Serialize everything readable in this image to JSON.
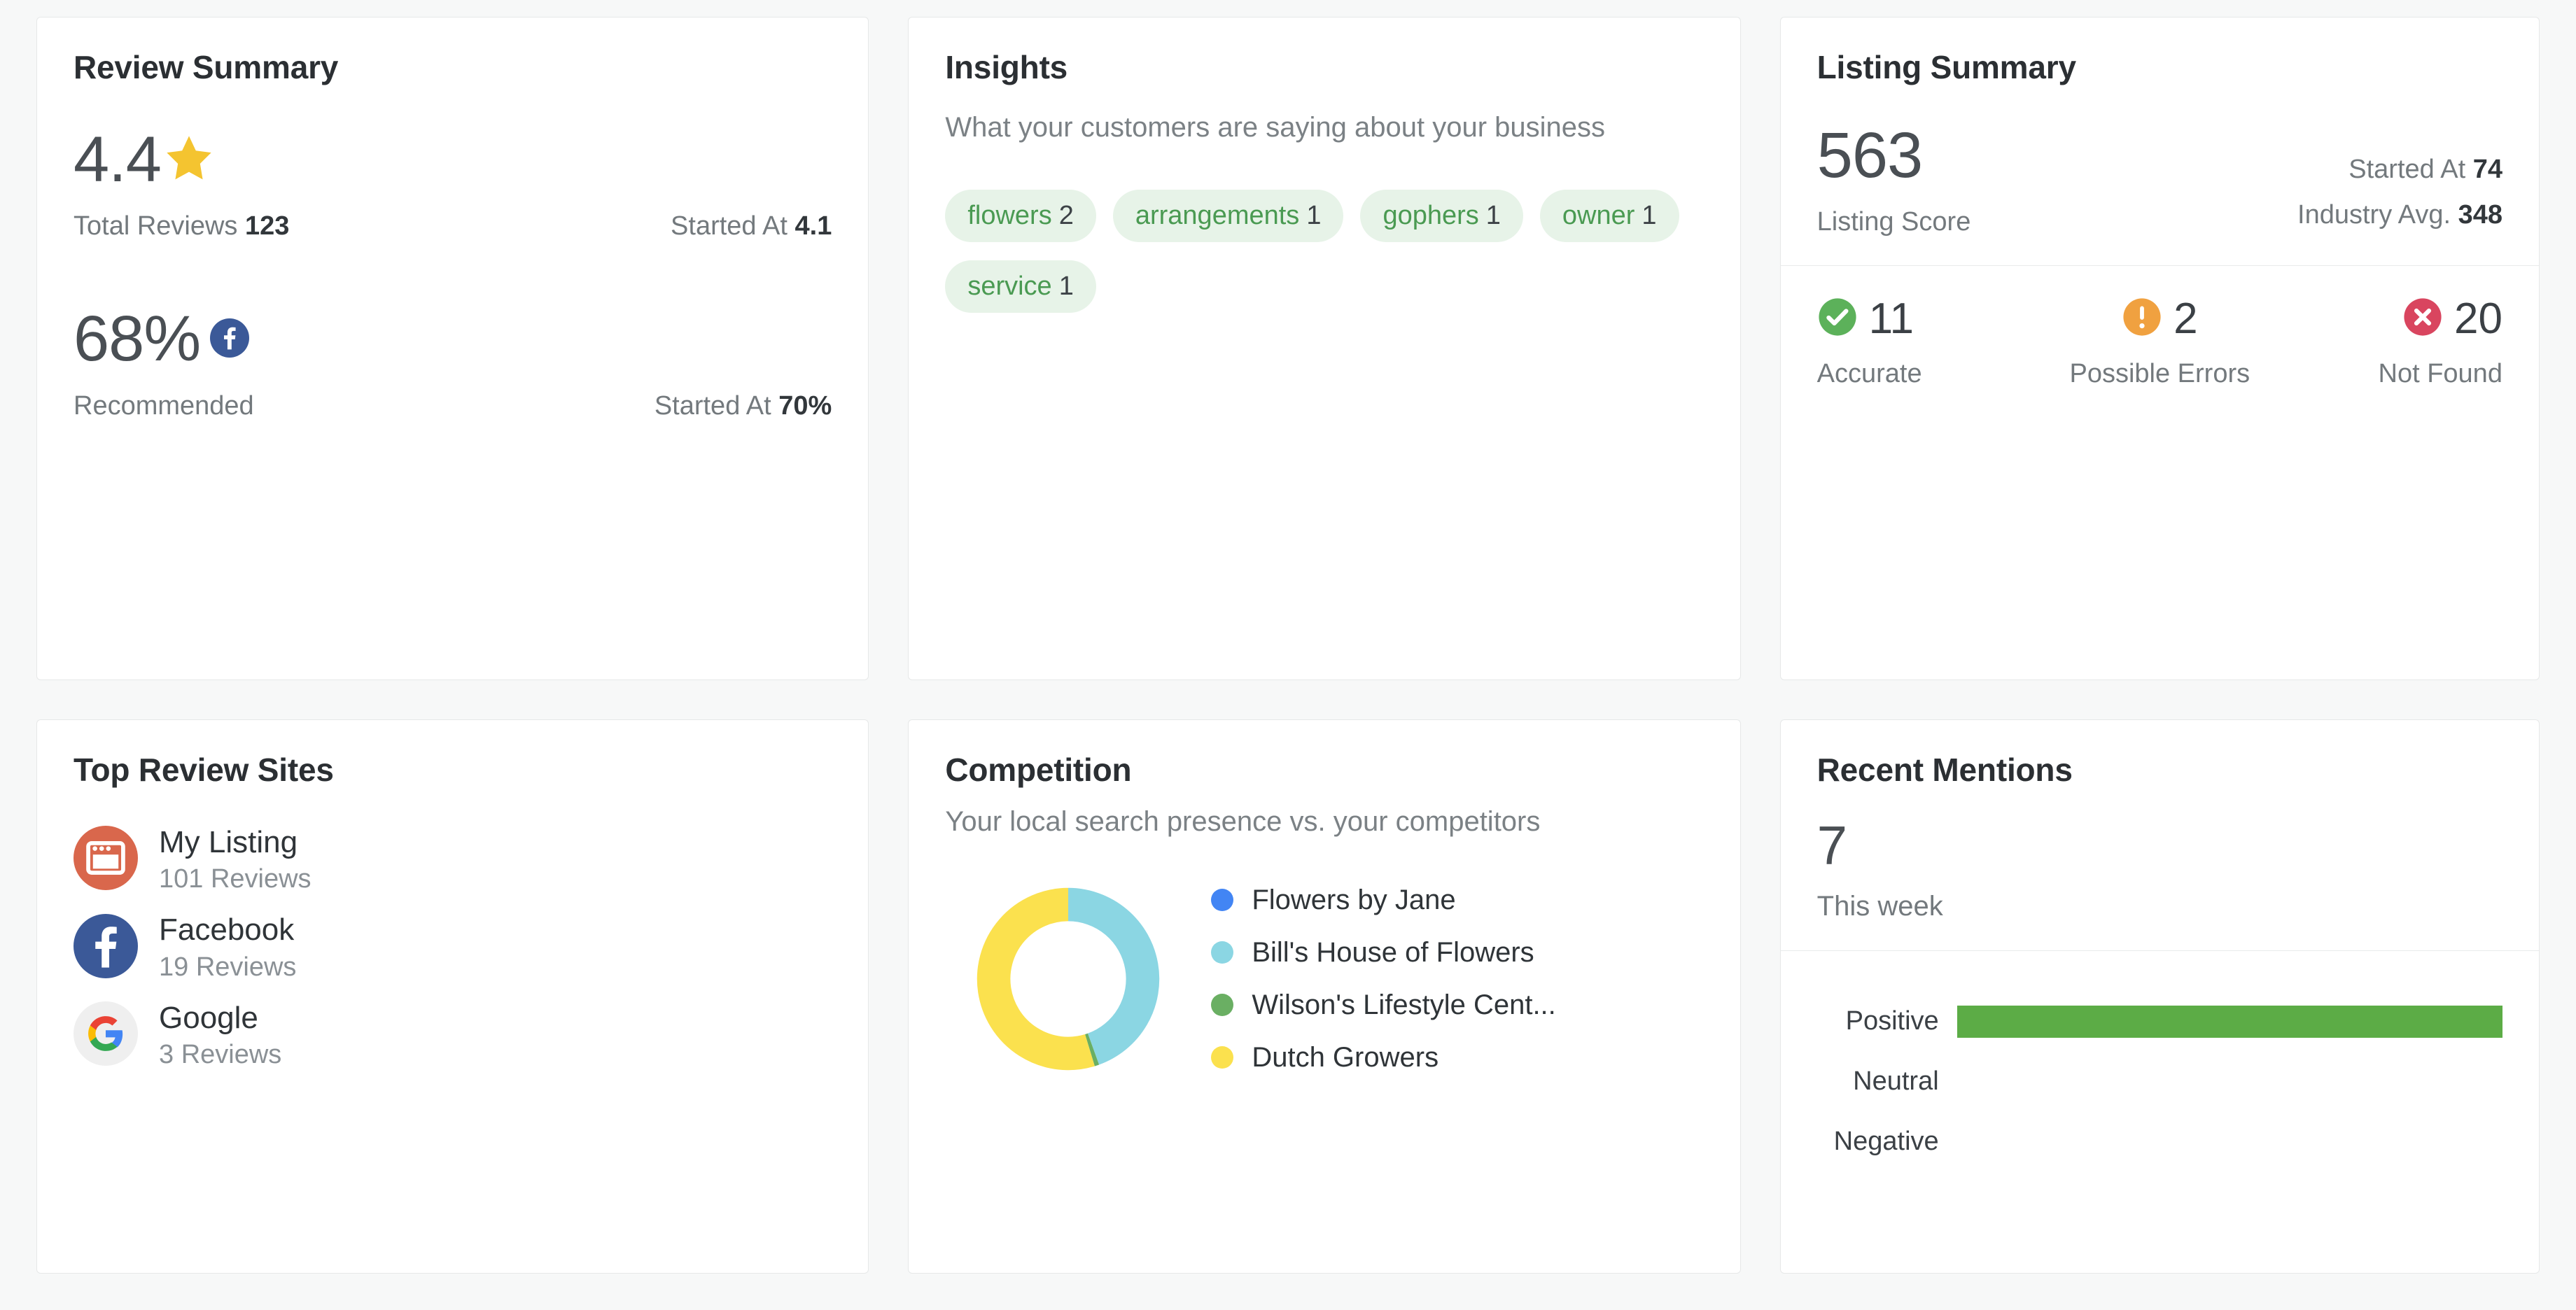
{
  "review_summary": {
    "title": "Review Summary",
    "rating": "4.4",
    "rating_icon": "star-icon",
    "total_reviews_label": "Total Reviews",
    "total_reviews_value": "123",
    "rating_started_label": "Started At",
    "rating_started_value": "4.1",
    "recommend_percent": "68%",
    "recommend_icon": "facebook-icon",
    "recommend_label": "Recommended",
    "recommend_started_label": "Started At",
    "recommend_started_value": "70%"
  },
  "insights": {
    "title": "Insights",
    "subtitle": "What your customers are saying about your business",
    "tags": [
      {
        "label": "flowers",
        "count": "2"
      },
      {
        "label": "arrangements",
        "count": "1"
      },
      {
        "label": "gophers",
        "count": "1"
      },
      {
        "label": "owner",
        "count": "1"
      },
      {
        "label": "service",
        "count": "1"
      }
    ]
  },
  "listing_summary": {
    "title": "Listing Summary",
    "score": "563",
    "score_label": "Listing Score",
    "started_label": "Started At",
    "started_value": "74",
    "industry_label": "Industry Avg.",
    "industry_value": "348",
    "statuses": [
      {
        "icon": "check-circle-icon",
        "value": "11",
        "label": "Accurate",
        "color": "#5cb15a"
      },
      {
        "icon": "warning-circle-icon",
        "value": "2",
        "label": "Possible Errors",
        "color": "#f0a140"
      },
      {
        "icon": "error-circle-icon",
        "value": "20",
        "label": "Not Found",
        "color": "#d9455f"
      }
    ]
  },
  "top_review_sites": {
    "title": "Top Review Sites",
    "sites": [
      {
        "icon": "my-listing-icon",
        "name": "My Listing",
        "count": "101 Reviews",
        "color": "#d9674c"
      },
      {
        "icon": "facebook-icon",
        "name": "Facebook",
        "count": "19 Reviews",
        "color": "#3b5998"
      },
      {
        "icon": "google-icon",
        "name": "Google",
        "count": "3 Reviews",
        "color": "#efefef"
      }
    ]
  },
  "competition": {
    "title": "Competition",
    "subtitle": "Your local search presence vs. your competitors",
    "chart_data": {
      "type": "pie",
      "title": "Competition",
      "legend_position": "right",
      "categories": [
        "Flowers by Jane",
        "Bill's House of Flowers",
        "Wilson's Lifestyle Cent...",
        "Dutch Growers"
      ],
      "values": [
        0,
        44.5,
        0.8,
        54.7
      ],
      "colors": [
        "#4285f4",
        "#8bd6e3",
        "#6aaf63",
        "#fbe14e"
      ]
    }
  },
  "recent_mentions": {
    "title": "Recent Mentions",
    "count": "7",
    "period": "This week",
    "chart_data": {
      "type": "bar",
      "orientation": "horizontal",
      "categories": [
        "Positive",
        "Neutral",
        "Negative"
      ],
      "values": [
        100,
        0,
        0
      ],
      "xlabel": "",
      "ylabel": "",
      "xlim": [
        0,
        100
      ],
      "colors": [
        "#5cac46",
        "#5cac46",
        "#5cac46"
      ],
      "grid": false
    }
  }
}
